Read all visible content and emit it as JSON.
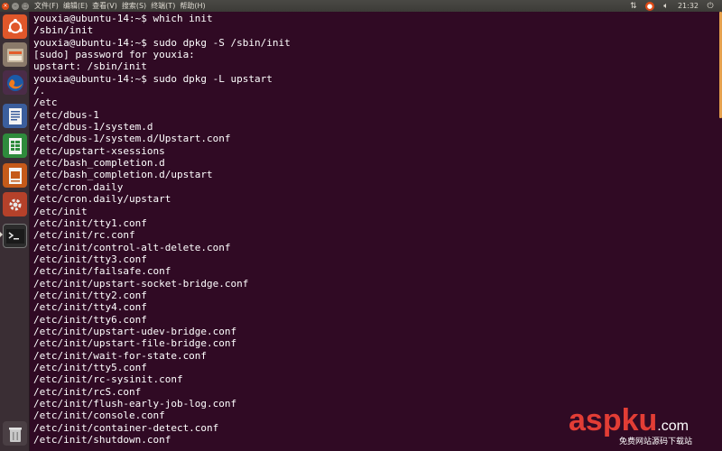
{
  "topbar": {
    "window_controls": [
      "close-icon",
      "minimize-icon",
      "maximize-icon"
    ],
    "menu": [
      "文件(F)",
      "编辑(E)",
      "查看(V)",
      "搜索(S)",
      "终端(T)",
      "帮助(H)"
    ],
    "time": "21:32",
    "indicator_icons": [
      "updown-arrows-icon",
      "recording-icon",
      "sound-icon",
      "power-icon"
    ]
  },
  "launcher": {
    "items": [
      {
        "name": "ubuntu-dash-icon"
      },
      {
        "name": "files-icon"
      },
      {
        "name": "firefox-icon"
      },
      {
        "name": "writer-icon"
      },
      {
        "name": "calc-icon"
      },
      {
        "name": "impress-icon"
      },
      {
        "name": "settings-icon"
      },
      {
        "name": "terminal-icon",
        "active": true
      },
      {
        "name": "trash-icon"
      }
    ]
  },
  "terminal": {
    "lines": [
      "youxia@ubuntu-14:~$ which init",
      "/sbin/init",
      "youxia@ubuntu-14:~$ sudo dpkg -S /sbin/init",
      "[sudo] password for youxia:",
      "upstart: /sbin/init",
      "youxia@ubuntu-14:~$ sudo dpkg -L upstart",
      "/.",
      "/etc",
      "/etc/dbus-1",
      "/etc/dbus-1/system.d",
      "/etc/dbus-1/system.d/Upstart.conf",
      "/etc/upstart-xsessions",
      "/etc/bash_completion.d",
      "/etc/bash_completion.d/upstart",
      "/etc/cron.daily",
      "/etc/cron.daily/upstart",
      "/etc/init",
      "/etc/init/tty1.conf",
      "/etc/init/rc.conf",
      "/etc/init/control-alt-delete.conf",
      "/etc/init/tty3.conf",
      "/etc/init/failsafe.conf",
      "/etc/init/upstart-socket-bridge.conf",
      "/etc/init/tty2.conf",
      "/etc/init/tty4.conf",
      "/etc/init/tty6.conf",
      "/etc/init/upstart-udev-bridge.conf",
      "/etc/init/upstart-file-bridge.conf",
      "/etc/init/wait-for-state.conf",
      "/etc/init/tty5.conf",
      "/etc/init/rc-sysinit.conf",
      "/etc/init/rcS.conf",
      "/etc/init/flush-early-job-log.conf",
      "/etc/init/console.conf",
      "/etc/init/container-detect.conf",
      "/etc/init/shutdown.conf"
    ]
  },
  "watermark": {
    "brand_asp": "asp",
    "brand_ku": "ku",
    "brand_dot": ".com",
    "tagline": "免费网站源码下载站"
  },
  "colors": {
    "terminal_bg": "#300a24",
    "terminal_text": "#ffffff",
    "scroll_thumb": "#e5a04d",
    "watermark_red": "#e23d35"
  }
}
